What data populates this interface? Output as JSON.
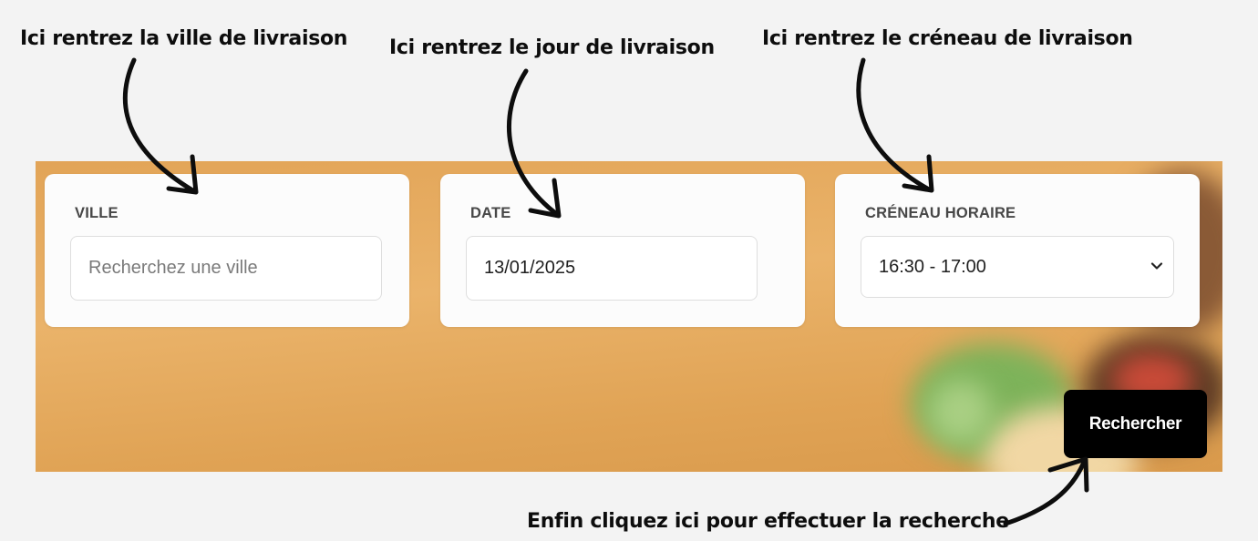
{
  "annotations": {
    "ville": "Ici rentrez la ville de livraison",
    "date": "Ici rentrez le jour de livraison",
    "slot": "Ici rentrez le créneau de livraison",
    "search": "Enfin cliquez ici pour effectuer la recherche"
  },
  "form": {
    "ville": {
      "label": "VILLE",
      "value": "",
      "placeholder": "Recherchez une ville"
    },
    "date": {
      "label": "DATE",
      "value": "13/01/2025"
    },
    "slot": {
      "label": "CRÉNEAU HORAIRE",
      "value": "16:30 - 17:00"
    }
  },
  "search_button": {
    "label": "Rechercher"
  },
  "colors": {
    "page_background": "#f3f3f3",
    "banner": "#e6aa5e",
    "button": "#000000",
    "arrow": "#0d0d0d"
  },
  "icons": {
    "dropdown": "chevron-down-icon"
  }
}
